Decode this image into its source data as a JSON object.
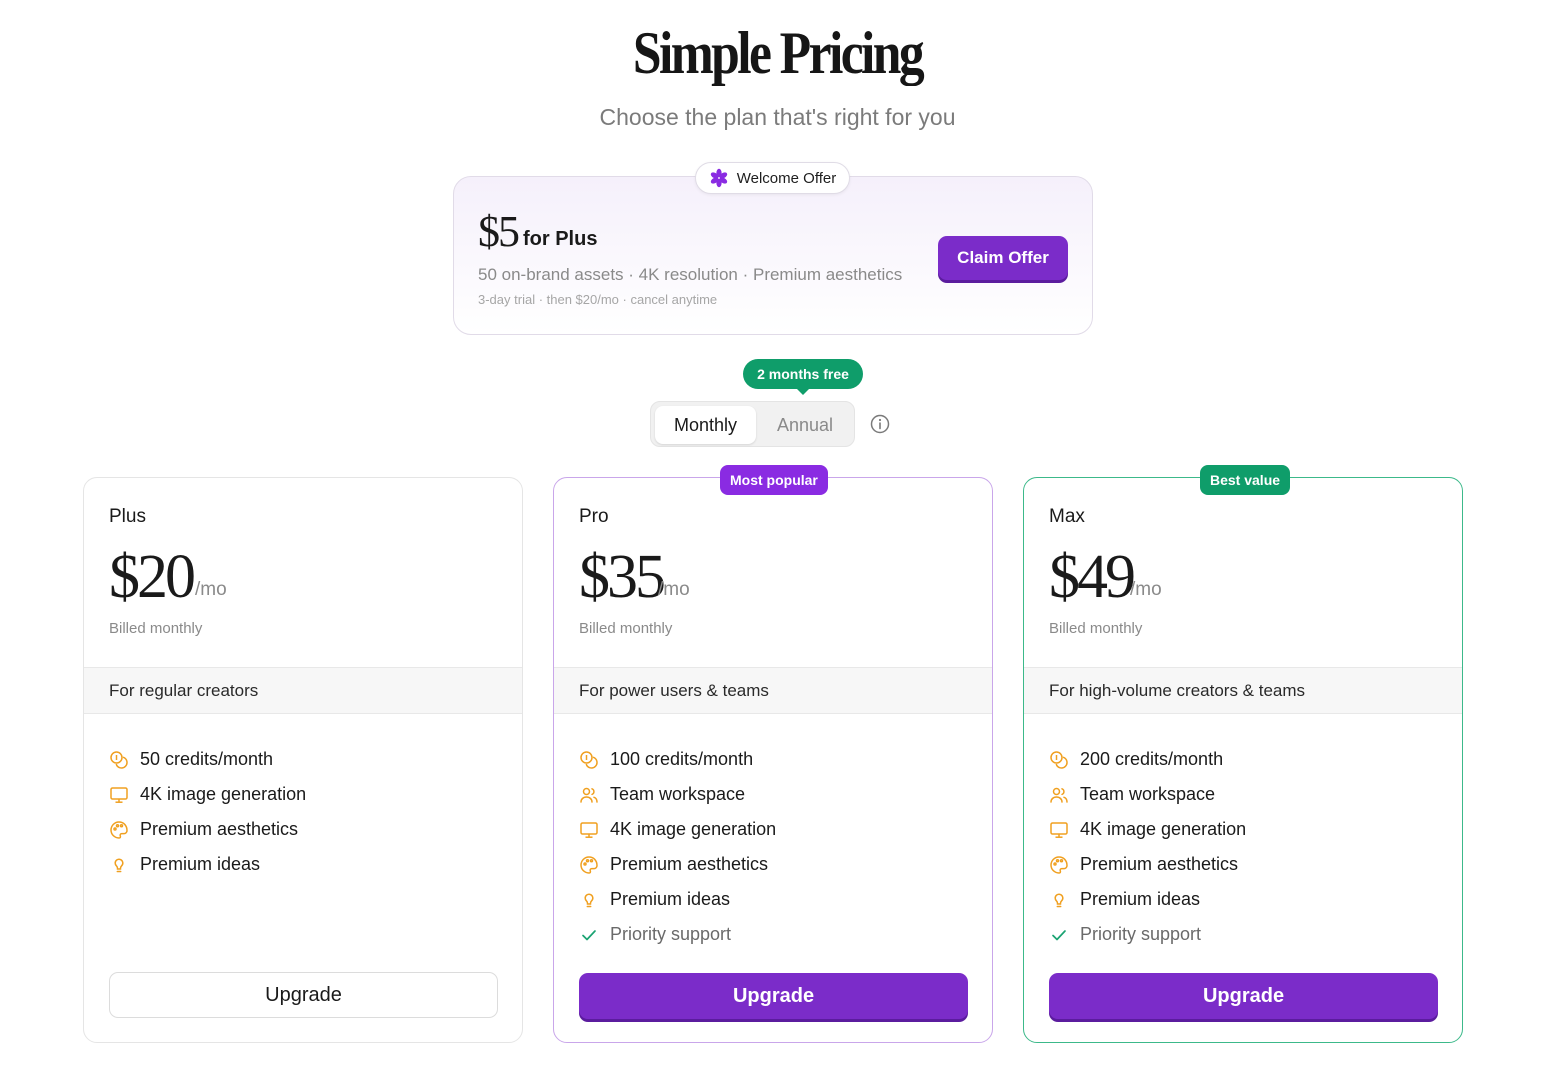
{
  "header": {
    "title": "Simple Pricing",
    "subtitle": "Choose the plan that's right for you"
  },
  "welcome_offer": {
    "tag_label": "Welcome Offer",
    "price": "$5",
    "price_suffix": "for Plus",
    "features": "50 on-brand assets · 4K resolution · Premium aesthetics",
    "note": "3-day trial · then $20/mo · cancel anytime",
    "cta_label": "Claim Offer"
  },
  "billing_toggle": {
    "badge": "2 months free",
    "options": [
      "Monthly",
      "Annual"
    ],
    "selected": "Monthly"
  },
  "plans": [
    {
      "name": "Plus",
      "price": "$20",
      "per": "/mo",
      "billing": "Billed monthly",
      "audience": "For regular creators",
      "features": [
        {
          "icon": "coins-icon",
          "label": "50 credits/month"
        },
        {
          "icon": "monitor-icon",
          "label": "4K image generation"
        },
        {
          "icon": "palette-icon",
          "label": "Premium aesthetics"
        },
        {
          "icon": "lightbulb-icon",
          "label": "Premium ideas"
        }
      ],
      "cta_label": "Upgrade"
    },
    {
      "name": "Pro",
      "badge": "Most popular",
      "price": "$35",
      "per": "/mo",
      "billing": "Billed monthly",
      "audience": "For power users & teams",
      "features": [
        {
          "icon": "coins-icon",
          "label": "100 credits/month"
        },
        {
          "icon": "users-icon",
          "label": "Team workspace"
        },
        {
          "icon": "monitor-icon",
          "label": "4K image generation"
        },
        {
          "icon": "palette-icon",
          "label": "Premium aesthetics"
        },
        {
          "icon": "lightbulb-icon",
          "label": "Premium ideas"
        },
        {
          "icon": "check-icon",
          "label": "Priority support"
        }
      ],
      "cta_label": "Upgrade"
    },
    {
      "name": "Max",
      "badge": "Best value",
      "price": "$49",
      "per": "/mo",
      "billing": "Billed monthly",
      "audience": "For high-volume creators & teams",
      "features": [
        {
          "icon": "coins-icon",
          "label": "200 credits/month"
        },
        {
          "icon": "users-icon",
          "label": "Team workspace"
        },
        {
          "icon": "monitor-icon",
          "label": "4K image generation"
        },
        {
          "icon": "palette-icon",
          "label": "Premium aesthetics"
        },
        {
          "icon": "lightbulb-icon",
          "label": "Premium ideas"
        },
        {
          "icon": "check-icon",
          "label": "Priority support"
        }
      ],
      "cta_label": "Upgrade"
    }
  ],
  "colors": {
    "accent_purple": "#7b2cc9",
    "badge_purple": "#8a2be2",
    "green": "#0f9d6a",
    "icon_orange": "#f0a020",
    "check_green": "#1aa372"
  }
}
